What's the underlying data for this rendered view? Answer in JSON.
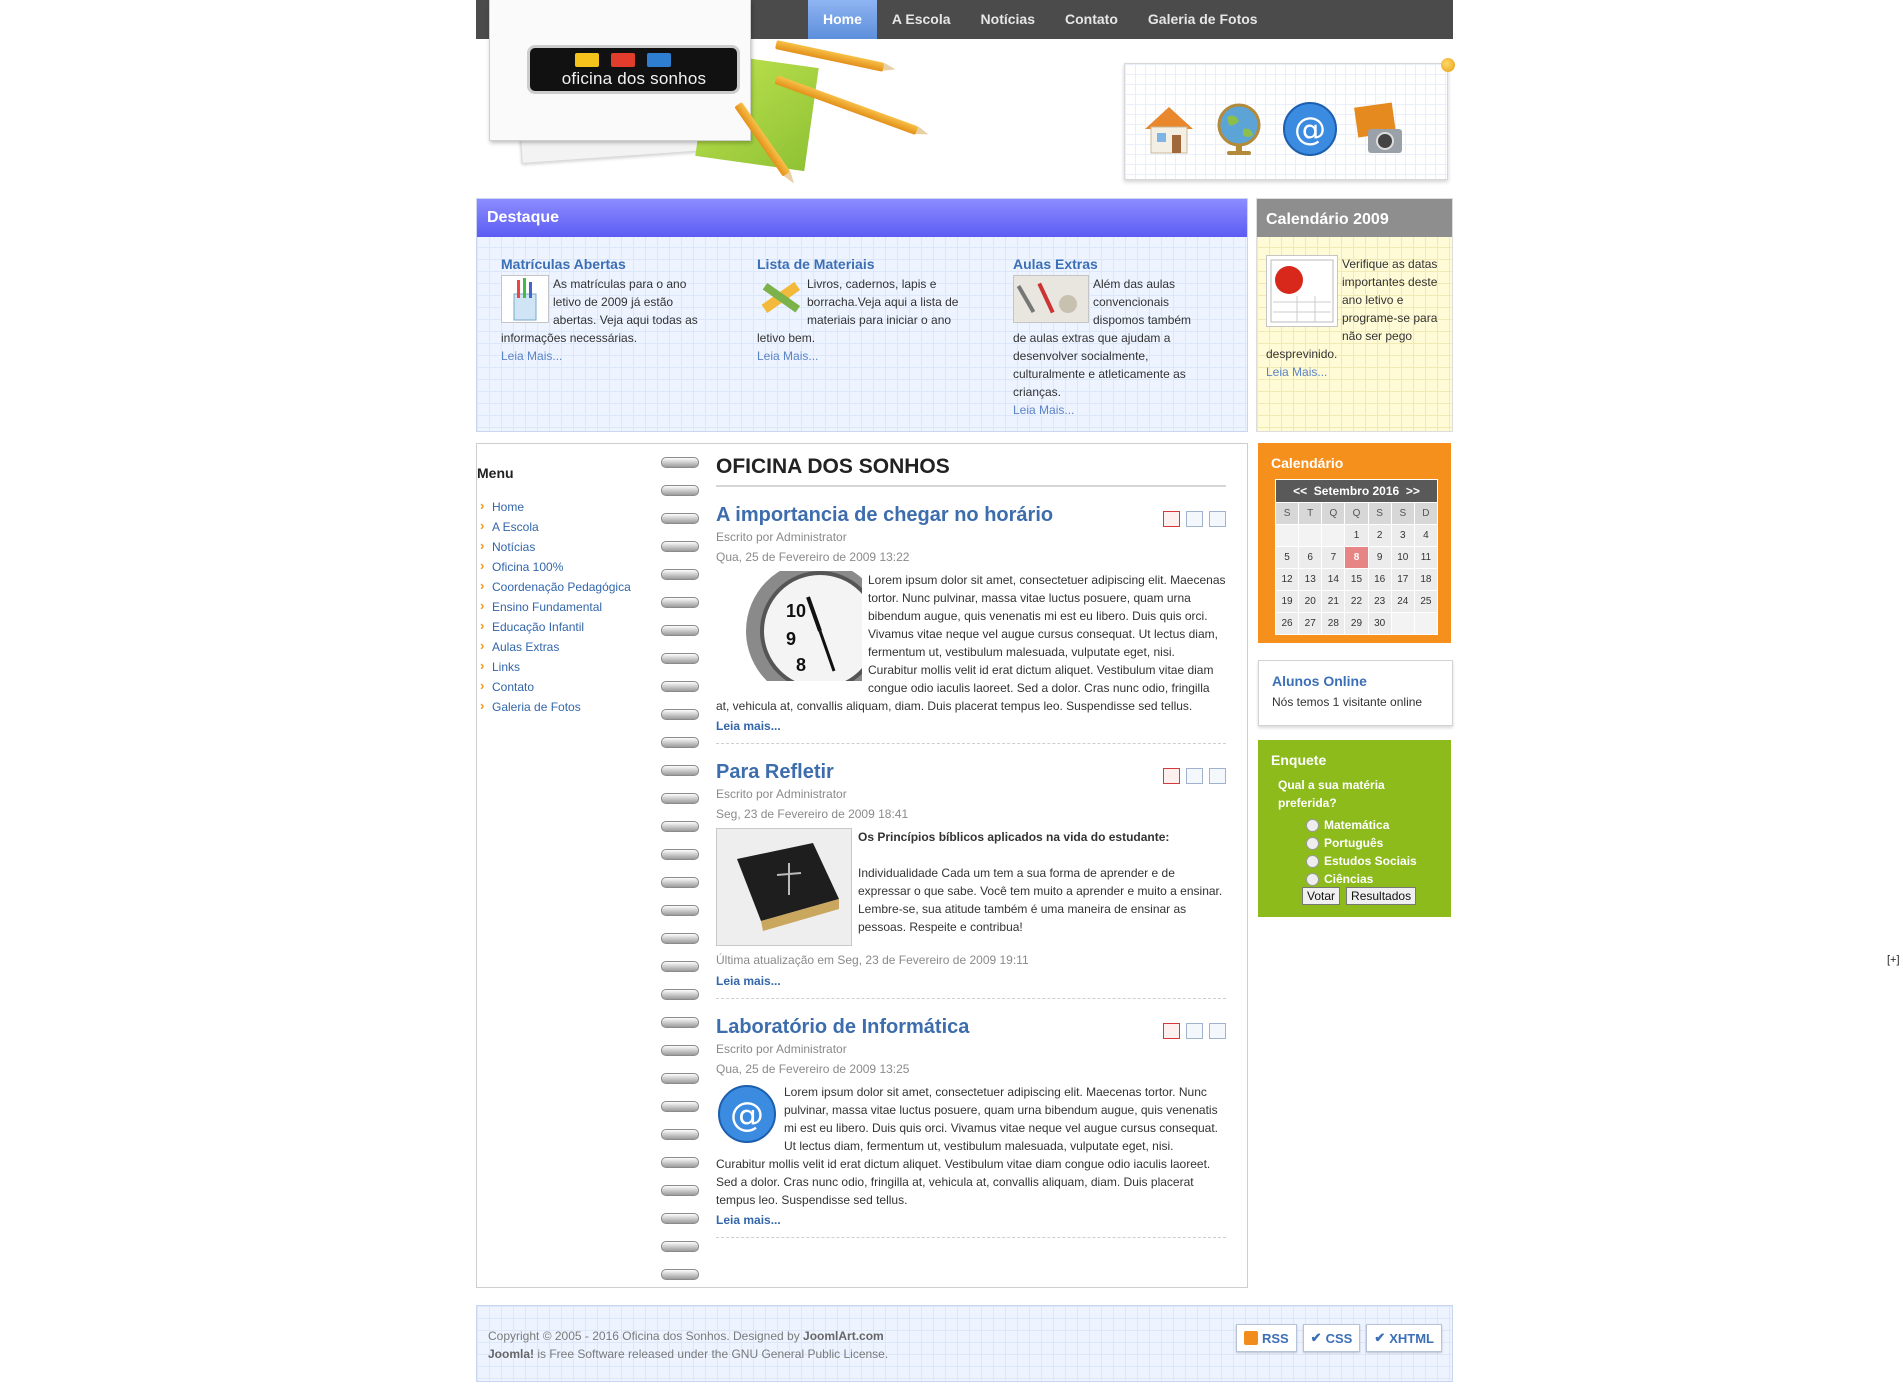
{
  "nav": {
    "items": [
      "Home",
      "A Escola",
      "Notícias",
      "Contato",
      "Galeria de Fotos"
    ],
    "active": "Home"
  },
  "header": {
    "logo_text": "oficina dos sonhos",
    "quick_icons": [
      "home-icon",
      "globe-icon",
      "email-icon",
      "photo-camera-icon"
    ]
  },
  "destaque": {
    "title": "Destaque",
    "items": [
      {
        "title": "Matrículas Abertas",
        "text": "As matrículas para o ano letivo de 2009 já estão abertas. Veja aqui todas as informações necessárias.",
        "more": "Leia Mais..."
      },
      {
        "title": "Lista de Materiais",
        "text": "Livros, cadernos, lapis e borracha.Veja aqui a lista de materiais para iniciar o ano letivo bem.",
        "more": "Leia Mais..."
      },
      {
        "title": "Aulas Extras",
        "text": "Além das aulas convencionais dispomos também de aulas extras que ajudam a desenvolver socialmente, culturalmente e atleticamente as crianças.",
        "more": "Leia Mais..."
      }
    ]
  },
  "calendario2009": {
    "title": "Calendário 2009",
    "text": "Verifique as datas importantes deste ano letivo e programe-se para não ser pego desprevinido.",
    "more": "Leia Mais..."
  },
  "menu": {
    "title": "Menu",
    "items": [
      "Home",
      "A Escola",
      "Notícias",
      "Oficina 100%",
      "Coordenação Pedagógica",
      "Ensino Fundamental",
      "Educação Infantil",
      "Aulas Extras",
      "Links",
      "Contato",
      "Galeria de Fotos"
    ]
  },
  "main": {
    "page_title": "OFICINA DOS SONHOS",
    "articles": [
      {
        "title": "A importancia de chegar no horário",
        "author": "Escrito por Administrator",
        "date": "Qua, 25 de Fevereiro de 2009 13:22",
        "body": "Lorem ipsum dolor sit amet, consectetuer adipiscing elit. Maecenas tortor. Nunc pulvinar, massa vitae luctus posuere, quam urna bibendum augue, quis venenatis mi est eu libero. Duis quis orci. Vivamus vitae neque vel augue cursus consequat. Ut lectus diam, fermentum ut, vestibulum malesuada, vulputate eget, nisi. Curabitur mollis velit id erat dictum aliquet. Vestibulum vitae diam congue odio iaculis laoreet. Sed a dolor. Cras nunc odio, fringilla at, vehicula at, convallis aliquam, diam. Duis placerat tempus leo. Suspendisse sed tellus.",
        "more": "Leia mais..."
      },
      {
        "title": "Para Refletir",
        "author": "Escrito por Administrator",
        "date": "Seg, 23 de Fevereiro de 2009 18:41",
        "lead": "Os Princípios bíblicos aplicados na vida do estudante:",
        "body": "Individualidade Cada um tem a sua forma de aprender e de expressar o que sabe. Você tem muito a aprender e muito a ensinar. Lembre-se, sua atitude também é uma maneira de ensinar as pessoas. Respeite e contribua!",
        "updated": "Última atualização em Seg, 23 de Fevereiro de 2009 19:11",
        "more": "Leia mais..."
      },
      {
        "title": "Laboratório de Informática",
        "author": "Escrito por Administrator",
        "date": "Qua, 25 de Fevereiro de 2009 13:25",
        "body": "Lorem ipsum dolor sit amet, consectetuer adipiscing elit. Maecenas tortor. Nunc pulvinar, massa vitae luctus posuere, quam urna bibendum augue, quis venenatis mi est eu libero. Duis quis orci. Vivamus vitae neque vel augue cursus consequat. Ut lectus diam, fermentum ut, vestibulum malesuada, vulputate eget, nisi. Curabitur mollis velit id erat dictum aliquet. Vestibulum vitae diam congue odio iaculis laoreet. Sed a dolor. Cras nunc odio, fringilla at, vehicula at, convallis aliquam, diam. Duis placerat tempus leo. Suspendisse sed tellus.",
        "more": "Leia mais..."
      }
    ]
  },
  "calendar": {
    "title": "Calendário",
    "prev": "<<",
    "month": "Setembro 2016",
    "next": ">>",
    "weekdays": [
      "S",
      "T",
      "Q",
      "Q",
      "S",
      "S",
      "D"
    ],
    "weeks": [
      [
        "",
        "",
        "",
        "1",
        "2",
        "3",
        "4"
      ],
      [
        "5",
        "6",
        "7",
        "8",
        "9",
        "10",
        "11"
      ],
      [
        "12",
        "13",
        "14",
        "15",
        "16",
        "17",
        "18"
      ],
      [
        "19",
        "20",
        "21",
        "22",
        "23",
        "24",
        "25"
      ],
      [
        "26",
        "27",
        "28",
        "29",
        "30",
        "",
        ""
      ]
    ],
    "today": "8"
  },
  "online": {
    "title": "Alunos Online",
    "text": "Nós temos 1 visitante online"
  },
  "poll": {
    "title": "Enquete",
    "question": "Qual a sua matéria preferida?",
    "options": [
      "Matemática",
      "Português",
      "Estudos Sociais",
      "Ciências"
    ],
    "vote": "Votar",
    "results": "Resultados"
  },
  "expand_toggle": "[+]",
  "footer": {
    "line1_prefix": "Copyright © 2005 - 2016 Oficina dos Sonhos. Designed by ",
    "line1_brand": "JoomlArt.com",
    "line2_brand": "Joomla!",
    "line2_text": " is Free Software released under the GNU General Public License.",
    "badges": [
      "RSS",
      "CSS",
      "XHTML"
    ]
  },
  "colors": {
    "nav_bg": "#4b4b4b",
    "destaque_head": "#6b6bf7",
    "calendar_bg": "#f5901d",
    "poll_bg": "#8cbb1b",
    "link": "#3366aa"
  }
}
